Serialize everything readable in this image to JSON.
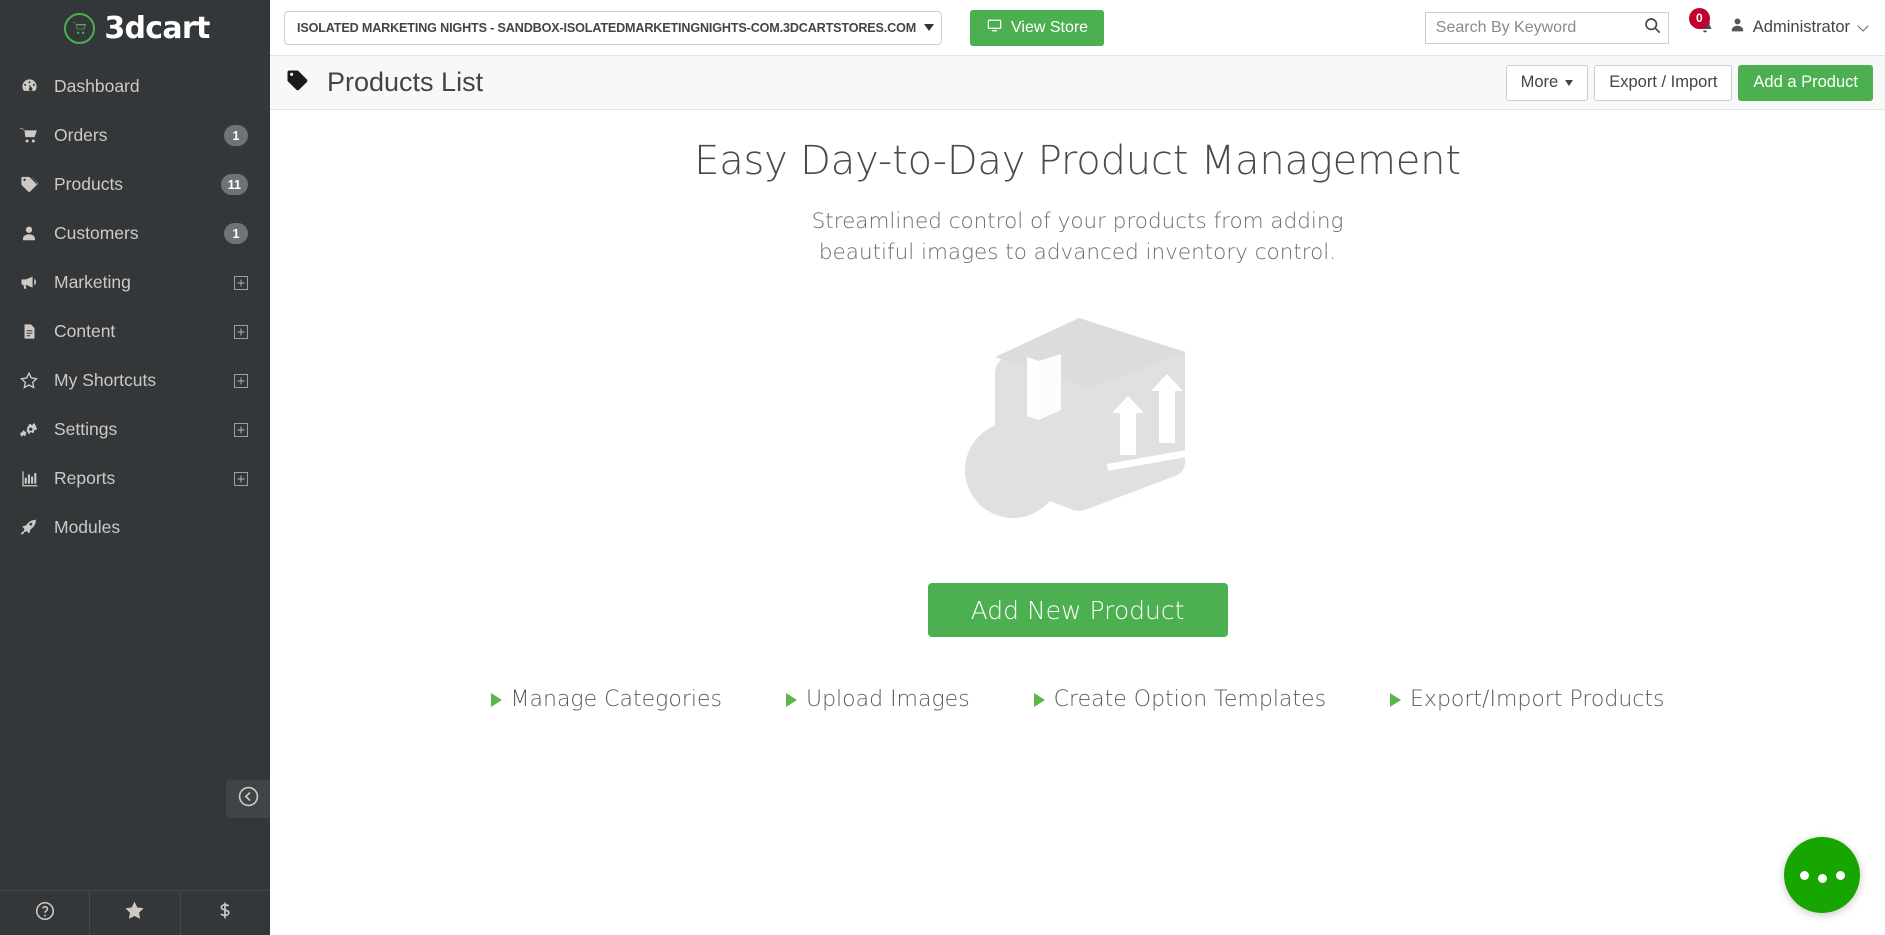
{
  "brand": {
    "name": "3dcart",
    "accent_color": "#4caf50",
    "logo_icon": "shopping-cart-icon"
  },
  "sidebar": {
    "items": [
      {
        "label": "Dashboard",
        "icon": "dashboard-gauge-icon",
        "badge": null,
        "expandable": false
      },
      {
        "label": "Orders",
        "icon": "shopping-cart-icon",
        "badge": "1",
        "expandable": false
      },
      {
        "label": "Products",
        "icon": "tag-icon",
        "badge": "11",
        "expandable": false
      },
      {
        "label": "Customers",
        "icon": "user-icon",
        "badge": "1",
        "expandable": false
      },
      {
        "label": "Marketing",
        "icon": "megaphone-icon",
        "badge": null,
        "expandable": true
      },
      {
        "label": "Content",
        "icon": "document-icon",
        "badge": null,
        "expandable": true
      },
      {
        "label": "My Shortcuts",
        "icon": "star-icon",
        "badge": null,
        "expandable": true
      },
      {
        "label": "Settings",
        "icon": "gears-icon",
        "badge": null,
        "expandable": true
      },
      {
        "label": "Reports",
        "icon": "bar-chart-icon",
        "badge": null,
        "expandable": true
      },
      {
        "label": "Modules",
        "icon": "rocket-icon",
        "badge": null,
        "expandable": false
      }
    ],
    "collapse_icon": "arrow-circle-left-icon",
    "footer": [
      {
        "icon": "help-circle-icon"
      },
      {
        "icon": "star-icon"
      },
      {
        "icon": "dollar-sign-icon"
      }
    ]
  },
  "topbar": {
    "store_selector": "ISOLATED MARKETING NIGHTS - SANDBOX-ISOLATEDMARKETINGNIGHTS-COM.3DCARTSTORES.COM",
    "view_store_label": "View Store",
    "view_store_icon": "monitor-icon",
    "search_placeholder": "Search By Keyword",
    "search_value": "",
    "search_icon": "search-icon",
    "notification_count": "0",
    "notification_icon": "bell-icon",
    "admin_label": "Administrator",
    "admin_icon": "user-icon"
  },
  "page_header": {
    "title": "Products List",
    "title_icon": "tag-icon",
    "more_label": "More",
    "export_import_label": "Export / Import",
    "add_product_label": "Add a Product"
  },
  "empty_state": {
    "heading": "Easy Day-to-Day Product Management",
    "subtext": "Streamlined control of your products from adding beautiful images to advanced inventory control.",
    "illustration": "package-box-icon",
    "cta_label": "Add New Product",
    "links": [
      {
        "label": "Manage Categories"
      },
      {
        "label": "Upload Images"
      },
      {
        "label": "Create Option Templates"
      },
      {
        "label": "Export/Import Products"
      }
    ]
  },
  "fab": {
    "icon": "ellipsis-icon",
    "color": "#17a600"
  }
}
